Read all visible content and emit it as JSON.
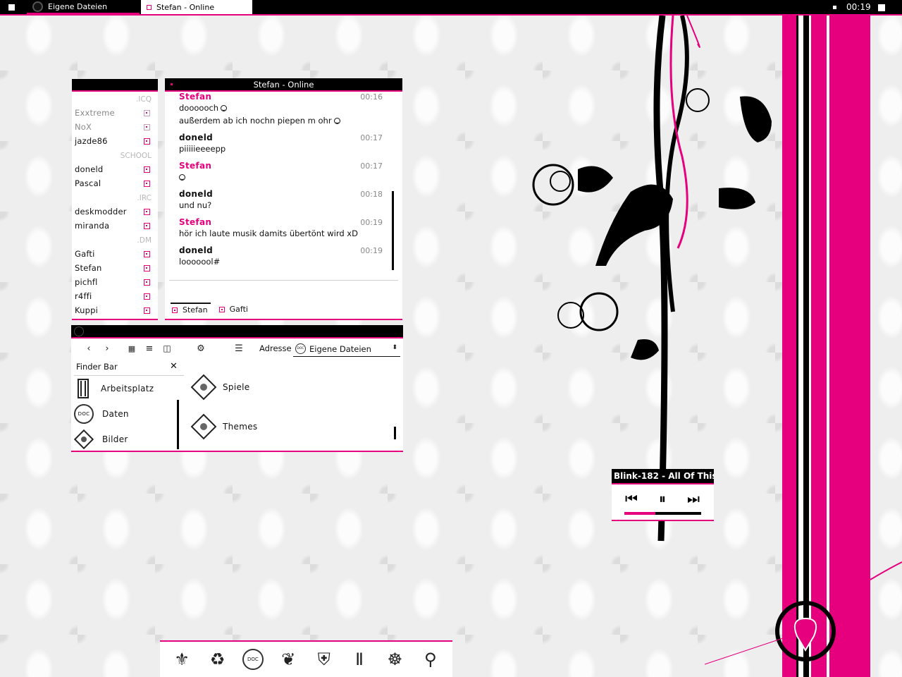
{
  "taskbar": {
    "tasks": [
      {
        "label": "Eigene Dateien",
        "active": false
      },
      {
        "label": "Stefan - Online",
        "active": true
      }
    ],
    "clock": "00:19"
  },
  "contact_list": {
    "groups": [
      {
        "name": ".ICQ",
        "contacts": [
          {
            "name": "Exxtreme",
            "online": false
          },
          {
            "name": "NoX",
            "online": false
          },
          {
            "name": "jazde86",
            "online": true
          }
        ]
      },
      {
        "name": "SCHOOL",
        "contacts": [
          {
            "name": "doneld",
            "online": true
          },
          {
            "name": "Pascal",
            "online": true
          }
        ]
      },
      {
        "name": ".IRC",
        "contacts": [
          {
            "name": "deskmodder",
            "online": true
          },
          {
            "name": "miranda",
            "online": true
          }
        ]
      },
      {
        "name": ".DM",
        "contacts": [
          {
            "name": "Gafti",
            "online": true
          },
          {
            "name": "Stefan",
            "online": true
          },
          {
            "name": "pichfl",
            "online": true
          },
          {
            "name": "r4ffi",
            "online": true
          },
          {
            "name": "Kuppi",
            "online": true
          }
        ]
      }
    ]
  },
  "chat": {
    "title": "Stefan - Online",
    "messages": [
      {
        "nick": "Stefan",
        "time": "00:16",
        "lines": [
          "doooooch",
          "außerdem ab ich nochn piepen m ohr"
        ]
      },
      {
        "nick": "doneld",
        "time": "00:17",
        "lines": [
          "piiiiieeeepp"
        ]
      },
      {
        "nick": "Stefan",
        "time": "00:17",
        "lines": [
          ""
        ]
      },
      {
        "nick": "doneld",
        "time": "00:18",
        "lines": [
          "und nu?"
        ]
      },
      {
        "nick": "Stefan",
        "time": "00:19",
        "lines": [
          "hör ich laute musik damits übertönt wird xD"
        ]
      },
      {
        "nick": "doneld",
        "time": "00:19",
        "lines": [
          "looooool#"
        ]
      }
    ],
    "tabs": [
      "Stefan",
      "Gafti"
    ]
  },
  "explorer": {
    "address_label": "Adresse",
    "address_value": "Eigene Dateien",
    "finder_title": "Finder Bar",
    "finder_items": [
      "Arbeitsplatz",
      "Daten",
      "Bilder"
    ],
    "items": [
      "Spiele",
      "Themes"
    ],
    "doc_badge": "DOC"
  },
  "player": {
    "track": "Blink-182 - All Of This",
    "progress": 0.4
  },
  "dock": {
    "icons": [
      "lily-icon",
      "recycle-icon",
      "doc-icon",
      "n-crest-icon",
      "shield-icon",
      "columns-icon",
      "emblem-icon",
      "keyhole-icon"
    ],
    "doc_label": "DOC"
  },
  "colors": {
    "accent": "#e6007e",
    "bar": "#000000",
    "panel": "#ffffff"
  }
}
